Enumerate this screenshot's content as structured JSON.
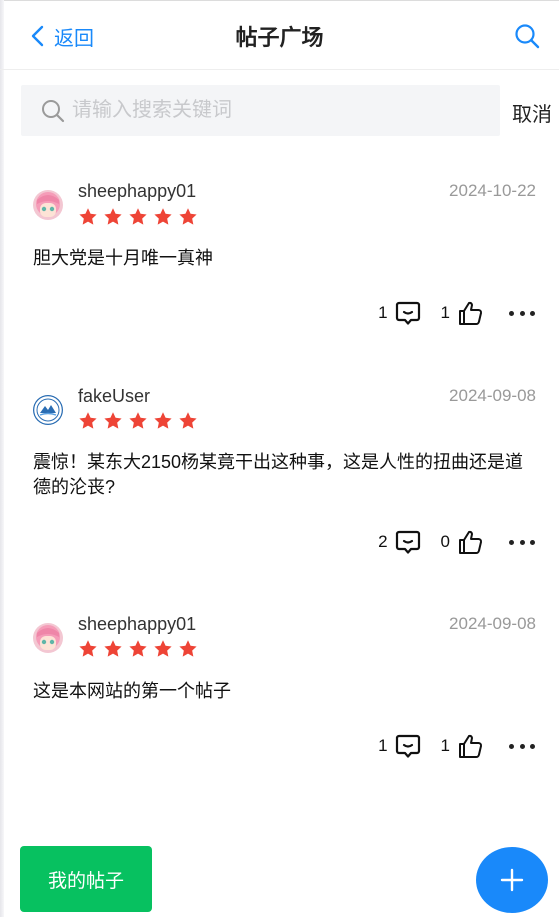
{
  "nav": {
    "back_label": "返回",
    "title": "帖子广场"
  },
  "search": {
    "placeholder": "请输入搜索关键词",
    "value": "",
    "cancel_label": "取消"
  },
  "posts": [
    {
      "username": "sheephappy01",
      "date": "2024-10-22",
      "rating": 5,
      "content": "胆大党是十月唯一真神",
      "comments": "1",
      "likes": "1",
      "avatar": "anime-pink-hair-avatar"
    },
    {
      "username": "fakeUser",
      "date": "2024-09-08",
      "rating": 5,
      "content": "震惊！某东大2150杨某竟干出这种事，这是人性的扭曲还是道德的沦丧?",
      "comments": "2",
      "likes": "0",
      "avatar": "university-emblem-avatar"
    },
    {
      "username": "sheephappy01",
      "date": "2024-09-08",
      "rating": 5,
      "content": "这是本网站的第一个帖子",
      "comments": "1",
      "likes": "1",
      "avatar": "anime-pink-hair-avatar"
    }
  ],
  "bottom": {
    "my_posts_label": "我的帖子",
    "add_icon": "plus-icon"
  },
  "colors": {
    "accent": "#1989fa",
    "star": "#ee4436",
    "green": "#07c160"
  }
}
